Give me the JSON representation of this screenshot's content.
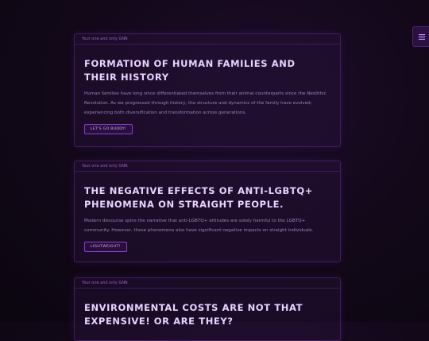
{
  "menu": {
    "icon": "hamburger-icon"
  },
  "cards": [
    {
      "header": "Your one and only GNN",
      "title": "Formation of Human Families and Their History",
      "text": "Human families have long since differentiated themselves from their animal counterparts since the Neolithic Revolution. As we progressed through history, the structure and dynamics of the family have evolved; experiencing both diversification and transformation across generations.",
      "button": "LET'S GO BUDDY!"
    },
    {
      "header": "Your one and only GNN",
      "title": "The negative effects of anti-LGBTQ+ phenomena on straight people.",
      "text": "Modern discourse spins the narrative that anti-LGBTQ+ attitudes are solely harmful to the LGBTQ+ community. However, these phenomena also have significant negative impacts on straight individuals.",
      "button": "LIGHTWEIGHT!"
    },
    {
      "header": "Your one and only GNN",
      "title": "Environmental costs are not that expensive! Or are they?"
    }
  ],
  "colors": {
    "accent": "#8a3fd0",
    "title": "#e8d2ff",
    "background": "#120818"
  }
}
